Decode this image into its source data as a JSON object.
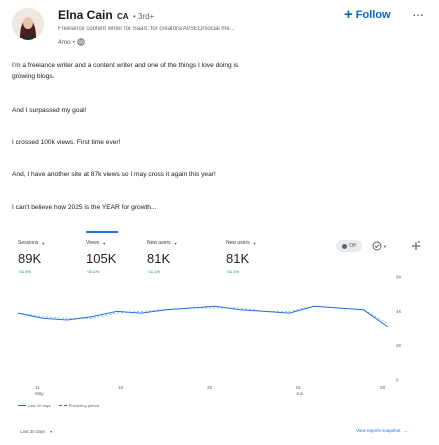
{
  "post": {
    "author_name": "Elna Cain",
    "author_badge": "CA",
    "connection_degree": "• 3rd+",
    "headline": "Freelance content writer for SaaS: for creators/AI/SEO/social me...",
    "time_ago": "4mo •",
    "follow_label": "Follow",
    "more_label": "···",
    "paragraphs": [
      "I'm a freelance writer and a content writer and one of the things I love doing is",
      "growing blogs.",
      "And I surpassed my goal!",
      "I crossed 100k views. First time ever!",
      "And, I have another site at 87k views so I may cross it again this year!",
      "I can't believe how 2025 is the YEAR for growth..."
    ]
  },
  "analytics": {
    "metrics": [
      {
        "label": "Sessions",
        "value": "89K",
        "change": "↑11.5%"
      },
      {
        "label": "Views",
        "value": "105K",
        "change": "↑10.1%"
      },
      {
        "label": "New users",
        "value": "81K",
        "change": "↑11.1%"
      },
      {
        "label": "New users",
        "value": "81K",
        "change": "↑11.1%"
      }
    ],
    "toggle_label": "Off",
    "x_ticks": [
      {
        "day": "11",
        "month": "May"
      },
      {
        "day": "18",
        "month": ""
      },
      {
        "day": "25",
        "month": ""
      },
      {
        "day": "01",
        "month": "Jun"
      },
      {
        "day": "08",
        "month": ""
      }
    ],
    "y_ticks": [
      "6K",
      "4K",
      "2K",
      "0"
    ],
    "legend_current": "Last 30 days",
    "legend_previous": "Preceding period",
    "range_label": "Last 30 days",
    "snapshot_link": "View reports snapshot"
  },
  "colors": {
    "accent": "#0a66c2",
    "series_current": "#1a73e8",
    "series_previous": "#1a73e8",
    "positive": "#188038"
  },
  "chart_data": {
    "type": "line",
    "x": [
      "May 11",
      "May 13",
      "May 15",
      "May 17",
      "May 19",
      "May 21",
      "May 23",
      "May 25",
      "May 27",
      "May 29",
      "May 31",
      "Jun 02",
      "Jun 04",
      "Jun 06",
      "Jun 08",
      "Jun 09"
    ],
    "series": [
      {
        "name": "Last 30 days",
        "values": [
          3.9,
          3.6,
          3.5,
          3.7,
          4.0,
          3.9,
          4.1,
          4.2,
          4.3,
          4.1,
          4.0,
          3.9,
          4.3,
          4.2,
          4.1,
          3.1
        ]
      },
      {
        "name": "Preceding period",
        "values": [
          3.9,
          3.7,
          3.6,
          3.6,
          3.9,
          4.0,
          4.1,
          4.2,
          4.2,
          4.2,
          4.0,
          4.0,
          4.3,
          4.2,
          4.1,
          3.3
        ]
      }
    ],
    "ylim": [
      0,
      7
    ],
    "y_ticks": [
      "6K",
      "4K",
      "2K",
      "0"
    ],
    "x_ticks": [
      "11 May",
      "18",
      "25",
      "01 Jun",
      "08"
    ],
    "grid": false,
    "legend": "bottom-left"
  },
  "icons": {
    "globe": "globe-icon",
    "plus": "plus-icon",
    "more": "more-horizontal-icon",
    "chevron": "chevron-down-icon",
    "check_circle": "check-circle-icon",
    "add_chart": "add-chart-icon",
    "arrow_right": "arrow-right-icon"
  }
}
